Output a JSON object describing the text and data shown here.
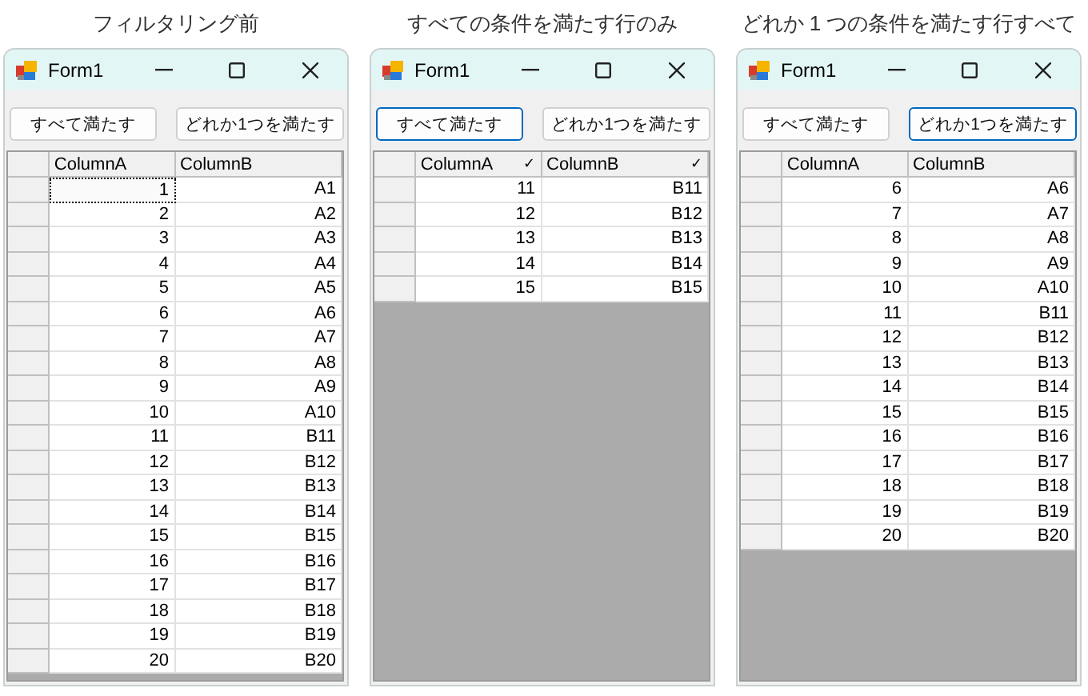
{
  "panels": [
    {
      "caption": "フィルタリング前",
      "window": {
        "title": "Form1"
      },
      "buttons": [
        {
          "label": "すべて満たす",
          "focused": false
        },
        {
          "label": "どれか1つを満たす",
          "focused": false
        }
      ],
      "columns": [
        {
          "label": "ColumnA"
        },
        {
          "label": "ColumnB"
        }
      ],
      "rows": [
        {
          "a": "1",
          "b": "A1",
          "current": true
        },
        {
          "a": "2",
          "b": "A2",
          "current": false
        },
        {
          "a": "3",
          "b": "A3",
          "current": false
        },
        {
          "a": "4",
          "b": "A4",
          "current": false
        },
        {
          "a": "5",
          "b": "A5",
          "current": false
        },
        {
          "a": "6",
          "b": "A6",
          "current": false
        },
        {
          "a": "7",
          "b": "A7",
          "current": false
        },
        {
          "a": "8",
          "b": "A8",
          "current": false
        },
        {
          "a": "9",
          "b": "A9",
          "current": false
        },
        {
          "a": "10",
          "b": "A10",
          "current": false
        },
        {
          "a": "11",
          "b": "B11",
          "current": false
        },
        {
          "a": "12",
          "b": "B12",
          "current": false
        },
        {
          "a": "13",
          "b": "B13",
          "current": false
        },
        {
          "a": "14",
          "b": "B14",
          "current": false
        },
        {
          "a": "15",
          "b": "B15",
          "current": false
        },
        {
          "a": "16",
          "b": "B16",
          "current": false
        },
        {
          "a": "17",
          "b": "B17",
          "current": false
        },
        {
          "a": "18",
          "b": "B18",
          "current": false
        },
        {
          "a": "19",
          "b": "B19",
          "current": false
        },
        {
          "a": "20",
          "b": "B20",
          "current": false
        }
      ]
    },
    {
      "caption": "すべての条件を満たす行のみ",
      "window": {
        "title": "Form1"
      },
      "buttons": [
        {
          "label": "すべて満たす",
          "focused": true
        },
        {
          "label": "どれか1つを満たす",
          "focused": false
        }
      ],
      "columns": [
        {
          "label": "ColumnA",
          "mark": "✓"
        },
        {
          "label": "ColumnB",
          "mark": "✓"
        }
      ],
      "rows": [
        {
          "a": "11",
          "b": "B11",
          "current": false
        },
        {
          "a": "12",
          "b": "B12",
          "current": false
        },
        {
          "a": "13",
          "b": "B13",
          "current": false
        },
        {
          "a": "14",
          "b": "B14",
          "current": false
        },
        {
          "a": "15",
          "b": "B15",
          "current": false
        }
      ]
    },
    {
      "caption": "どれか 1 つの条件を満たす行すべて",
      "window": {
        "title": "Form1"
      },
      "buttons": [
        {
          "label": "すべて満たす",
          "focused": false
        },
        {
          "label": "どれか1つを満たす",
          "focused": true
        }
      ],
      "columns": [
        {
          "label": "ColumnA"
        },
        {
          "label": "ColumnB"
        }
      ],
      "rows": [
        {
          "a": "6",
          "b": "A6",
          "current": false
        },
        {
          "a": "7",
          "b": "A7",
          "current": false
        },
        {
          "a": "8",
          "b": "A8",
          "current": false
        },
        {
          "a": "9",
          "b": "A9",
          "current": false
        },
        {
          "a": "10",
          "b": "A10",
          "current": false
        },
        {
          "a": "11",
          "b": "B11",
          "current": false
        },
        {
          "a": "12",
          "b": "B12",
          "current": false
        },
        {
          "a": "13",
          "b": "B13",
          "current": false
        },
        {
          "a": "14",
          "b": "B14",
          "current": false
        },
        {
          "a": "15",
          "b": "B15",
          "current": false
        },
        {
          "a": "16",
          "b": "B16",
          "current": false
        },
        {
          "a": "17",
          "b": "B17",
          "current": false
        },
        {
          "a": "18",
          "b": "B18",
          "current": false
        },
        {
          "a": "19",
          "b": "B19",
          "current": false
        },
        {
          "a": "20",
          "b": "B20",
          "current": false
        }
      ]
    }
  ]
}
